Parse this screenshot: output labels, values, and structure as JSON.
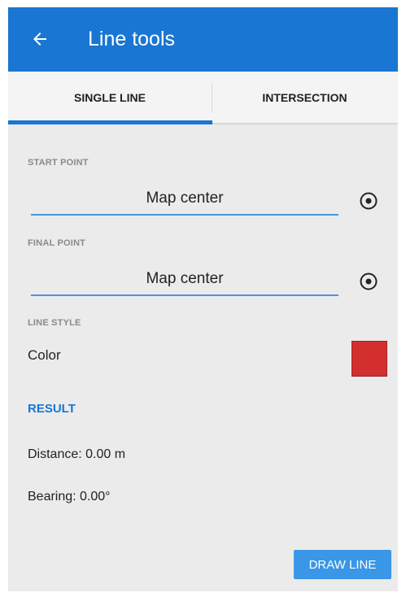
{
  "appbar": {
    "title": "Line tools",
    "back_icon": "arrow-left-icon",
    "color": "#1976d2"
  },
  "tabs": [
    {
      "label": "SINGLE LINE",
      "selected": true
    },
    {
      "label": "INTERSECTION",
      "selected": false
    }
  ],
  "start_point": {
    "section_label": "START POINT",
    "value": "Map center",
    "icon": "target-icon"
  },
  "final_point": {
    "section_label": "FINAL POINT",
    "value": "Map center",
    "icon": "target-icon"
  },
  "line_style": {
    "section_label": "LINE STYLE",
    "color_label": "Color",
    "color_value": "#d32f2f"
  },
  "result": {
    "section_label": "RESULT",
    "distance": "Distance: 0.00 m",
    "bearing": "Bearing: 0.00°"
  },
  "actions": {
    "draw_line_label": "DRAW LINE"
  }
}
